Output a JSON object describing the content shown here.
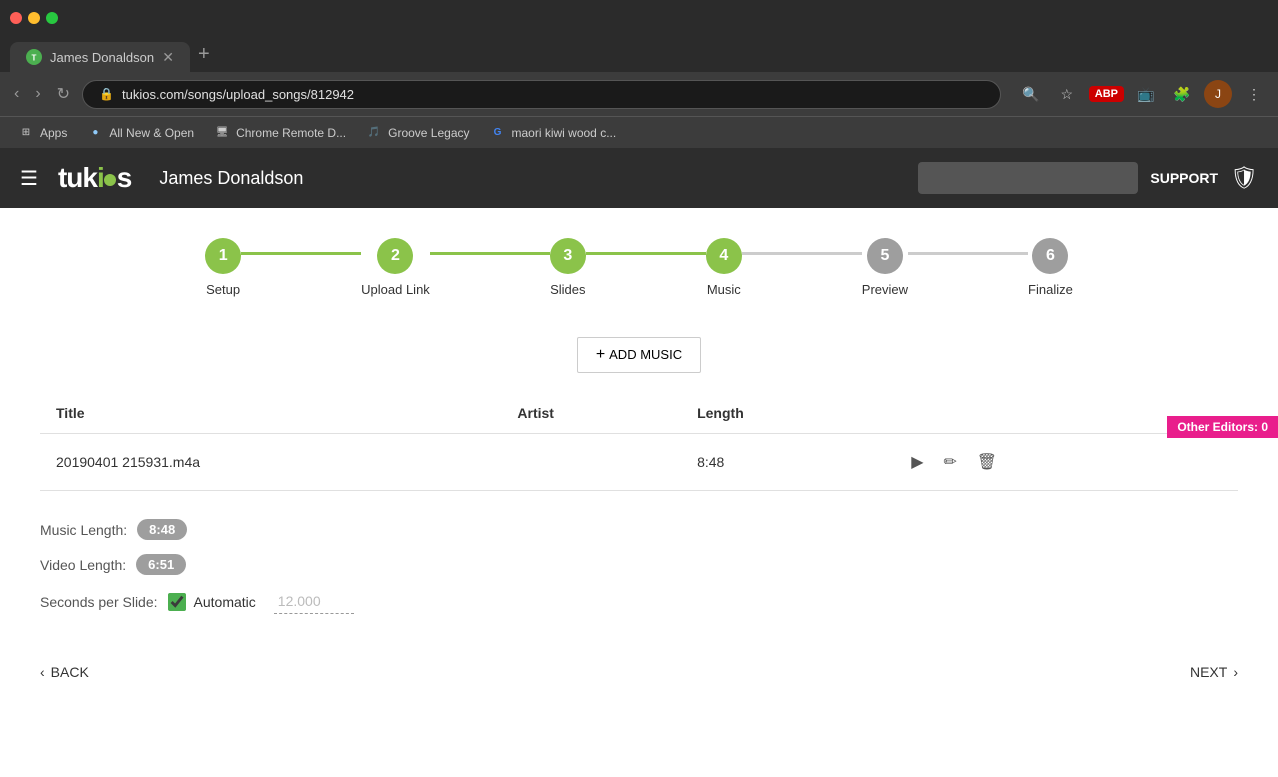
{
  "browser": {
    "tab_title": "James Donaldson",
    "tab_favicon": "J",
    "address": "tukios.com/songs/upload_songs/812942",
    "bookmarks": [
      {
        "label": "Apps",
        "icon": "⊞"
      },
      {
        "label": "All New & Open",
        "icon": "●"
      },
      {
        "label": "Chrome Remote D...",
        "icon": "🖥"
      },
      {
        "label": "Groove Legacy",
        "icon": "🎵"
      },
      {
        "label": "maori kiwi wood c...",
        "icon": "G"
      }
    ]
  },
  "header": {
    "logo": "tukios",
    "user_name": "James Donaldson",
    "search_placeholder": "",
    "support_label": "SUPPORT"
  },
  "other_editors": "Other Editors: 0",
  "stepper": {
    "steps": [
      {
        "number": "1",
        "label": "Setup",
        "state": "active"
      },
      {
        "number": "2",
        "label": "Upload Link",
        "state": "active"
      },
      {
        "number": "3",
        "label": "Slides",
        "state": "active"
      },
      {
        "number": "4",
        "label": "Music",
        "state": "active"
      },
      {
        "number": "5",
        "label": "Preview",
        "state": "inactive"
      },
      {
        "number": "6",
        "label": "Finalize",
        "state": "inactive"
      }
    ]
  },
  "add_music_label": "+ ADD MUSIC",
  "table": {
    "columns": [
      "Title",
      "Artist",
      "Length"
    ],
    "rows": [
      {
        "title": "20190401 215931.m4a",
        "artist": "",
        "length": "8:48"
      }
    ]
  },
  "music_info": {
    "music_length_label": "Music Length:",
    "music_length_value": "8:48",
    "video_length_label": "Video Length:",
    "video_length_value": "6:51",
    "seconds_per_slide_label": "Seconds per Slide:",
    "automatic_label": "Automatic",
    "auto_value": "12.000"
  },
  "navigation": {
    "back_label": "BACK",
    "next_label": "NEXT"
  }
}
